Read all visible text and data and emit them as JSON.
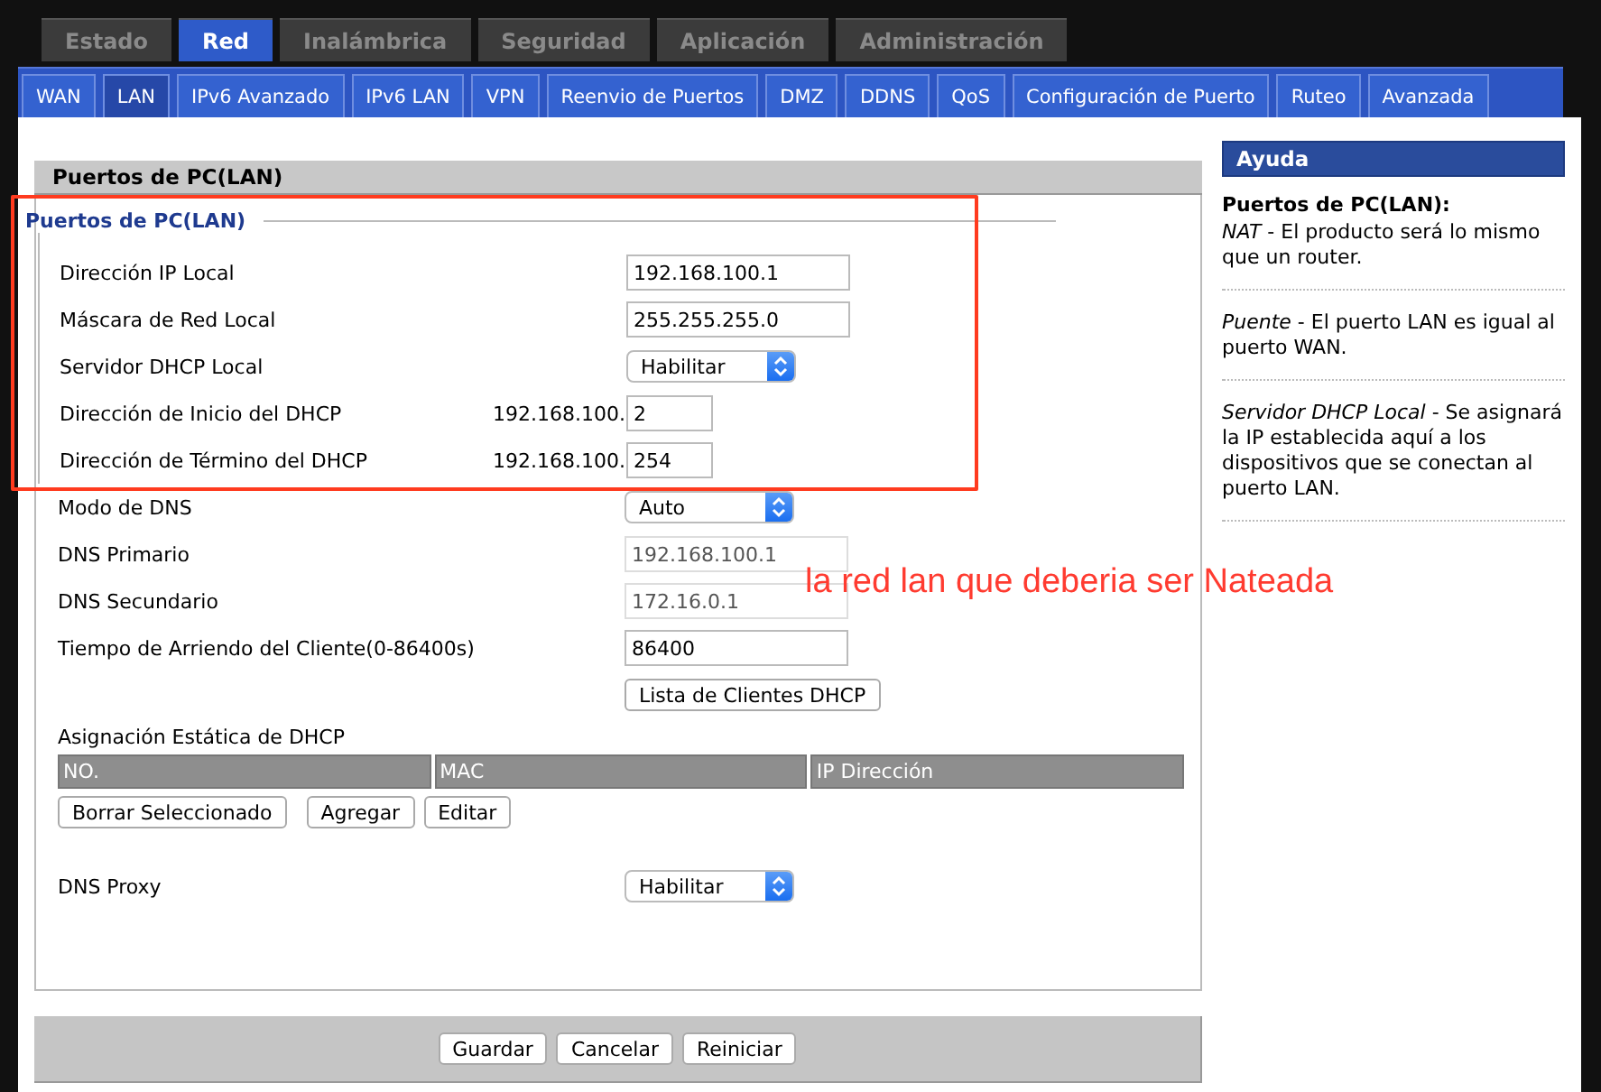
{
  "main_tabs": [
    {
      "label": "Estado",
      "selected": false
    },
    {
      "label": "Red",
      "selected": true
    },
    {
      "label": "Inalámbrica",
      "selected": false
    },
    {
      "label": "Seguridad",
      "selected": false
    },
    {
      "label": "Aplicación",
      "selected": false
    },
    {
      "label": "Administración",
      "selected": false
    }
  ],
  "sub_tabs": [
    {
      "label": "WAN",
      "selected": false
    },
    {
      "label": "LAN",
      "selected": true
    },
    {
      "label": "IPv6 Avanzado",
      "selected": false
    },
    {
      "label": "IPv6 LAN",
      "selected": false
    },
    {
      "label": "VPN",
      "selected": false
    },
    {
      "label": "Reenvio de Puertos",
      "selected": false
    },
    {
      "label": "DMZ",
      "selected": false
    },
    {
      "label": "DDNS",
      "selected": false
    },
    {
      "label": "QoS",
      "selected": false
    },
    {
      "label": "Configuración de Puerto",
      "selected": false
    },
    {
      "label": "Ruteo",
      "selected": false
    },
    {
      "label": "Avanzada",
      "selected": false
    }
  ],
  "panel": {
    "title": "Puertos de PC(LAN)"
  },
  "lan_section": {
    "legend": "Puertos de PC(LAN)",
    "rows": [
      {
        "kind": "input",
        "label": "Dirección IP Local",
        "value": "192.168.100.1",
        "disabled": false
      },
      {
        "kind": "input",
        "label": "Máscara de Red Local",
        "value": "255.255.255.0",
        "disabled": false
      },
      {
        "kind": "select",
        "label": "Servidor DHCP Local",
        "value": "Habilitar"
      },
      {
        "kind": "prefixed",
        "label": "Dirección de Inicio del DHCP",
        "prefix": "192.168.100.",
        "value": "2"
      },
      {
        "kind": "prefixed",
        "label": "Dirección de Término del DHCP",
        "prefix": "192.168.100.",
        "value": "254"
      }
    ]
  },
  "dns_rows": [
    {
      "kind": "select",
      "label": "Modo de DNS",
      "value": "Auto"
    },
    {
      "kind": "input",
      "label": "DNS Primario",
      "value": "192.168.100.1",
      "disabled": true
    },
    {
      "kind": "input",
      "label": "DNS Secundario",
      "value": "172.16.0.1",
      "disabled": true
    },
    {
      "kind": "input",
      "label": "Tiempo de Arriendo del Cliente(0-86400s)",
      "value": "86400",
      "disabled": false
    }
  ],
  "dhcp_clients_button": "Lista de Clientes DHCP",
  "static_dhcp": {
    "title": "Asignación Estática de DHCP",
    "columns": [
      "NO.",
      "MAC",
      "IP Dirección"
    ],
    "buttons": [
      "Borrar Seleccionado",
      "Agregar",
      "Editar"
    ]
  },
  "dns_proxy": {
    "label": "DNS Proxy",
    "value": "Habilitar"
  },
  "footer_buttons": [
    "Guardar",
    "Cancelar",
    "Reiniciar"
  ],
  "help": {
    "title": "Ayuda",
    "heading": "Puertos de PC(LAN):",
    "entries": [
      "*NAT* - El producto será lo mismo que un router.",
      "*Puente* - El puerto LAN es igual al puerto WAN.",
      "*Servidor DHCP Local* - Se asignará la IP establecida aquí a los dispositivos que se conectan al puerto LAN."
    ]
  },
  "annotation": {
    "text": "la red lan que deberia ser Nateada"
  }
}
